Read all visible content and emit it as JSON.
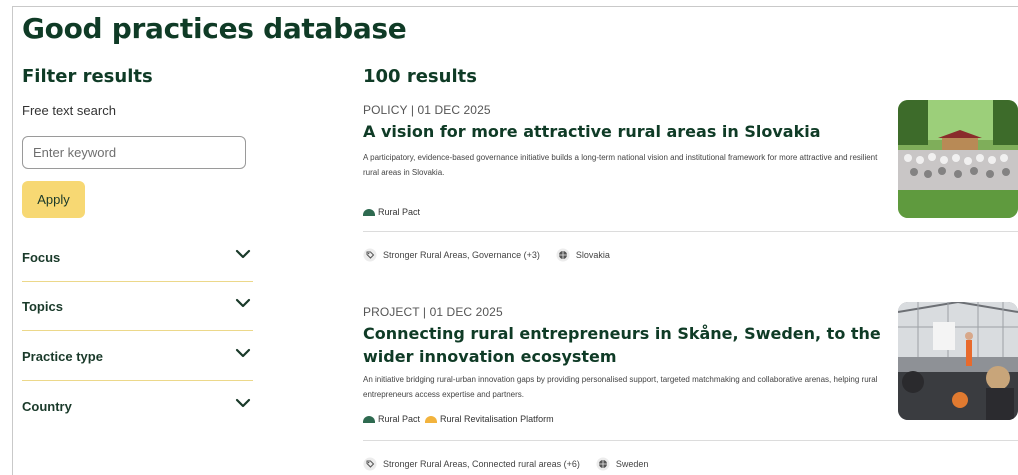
{
  "page": {
    "title": "Good practices database"
  },
  "filters": {
    "title": "Filter results",
    "search_label": "Free text search",
    "search_placeholder": "Enter keyword",
    "search_value": "",
    "apply_label": "Apply",
    "facets": [
      {
        "label": "Focus"
      },
      {
        "label": "Topics"
      },
      {
        "label": "Practice type"
      },
      {
        "label": "Country"
      }
    ]
  },
  "results": {
    "count_label": "100 results",
    "items": [
      {
        "meta": "POLICY | 01 DEC 2025",
        "title": "A vision for more attractive rural areas in Slovakia",
        "description": "A participatory, evidence-based governance initiative builds a long-term national vision and institutional framework for more attractive and resilient rural areas in Slovakia.",
        "tags": [
          {
            "label": "Rural Pact",
            "color": "#2e6a50"
          }
        ],
        "topics": "Stronger Rural Areas, Governance (+3)",
        "country": "Slovakia"
      },
      {
        "meta": "PROJECT | 01 DEC 2025",
        "title": "Connecting rural entrepreneurs in Skåne, Sweden, to the wider innovation ecosystem",
        "description": "An initiative bridging rural-urban innovation gaps by providing personalised support, targeted matchmaking and collaborative arenas, helping rural entrepreneurs access expertise and partners.",
        "tags": [
          {
            "label": "Rural Pact",
            "color": "#2e6a50"
          },
          {
            "label": "Rural Revitalisation Platform",
            "color": "#f2b33d"
          }
        ],
        "topics": "Stronger Rural Areas, Connected rural areas (+6)",
        "country": "Sweden"
      }
    ]
  },
  "icons": {
    "chevron": "chevron-down-icon",
    "tag": "tag-icon",
    "globe": "globe-icon"
  },
  "colors": {
    "heading": "#0f3b26",
    "apply_button": "#f7d873",
    "facet_divider": "#ecd88a"
  }
}
